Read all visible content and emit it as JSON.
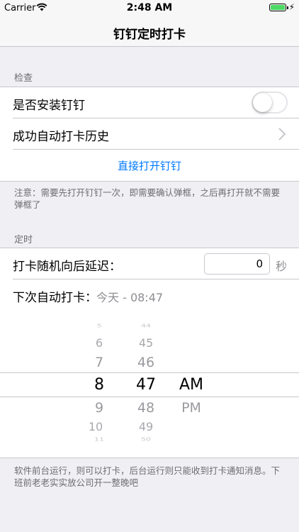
{
  "status_bar": {
    "carrier": "Carrier",
    "time": "2:48 AM",
    "battery_percent": 100
  },
  "nav": {
    "title": "钉钉定时打卡"
  },
  "check_section": {
    "header": "检查",
    "rows": [
      {
        "label": "是否安装钉钉",
        "toggle_on": false
      },
      {
        "label": "成功自动打卡历史"
      },
      {
        "action": "直接打开钉钉"
      }
    ],
    "note": "注意：需要先打开钉钉一次，即需要确认弹框，之后再打开就不需要弹框了"
  },
  "timer_section": {
    "header": "定时",
    "delay": {
      "label": "打卡随机向后延迟：",
      "value": "0",
      "unit": "秒"
    },
    "next": {
      "label": "下次自动打卡：",
      "value": "今天 - 08:47"
    },
    "picker": {
      "hours": [
        "5",
        "6",
        "7",
        "8",
        "9",
        "10",
        "11"
      ],
      "minutes": [
        "44",
        "45",
        "46",
        "47",
        "48",
        "49",
        "50"
      ],
      "periods": [
        "AM",
        "PM"
      ],
      "selected": {
        "hour": "8",
        "minute": "47",
        "period": "AM"
      }
    },
    "note": "软件前台运行，则可以打卡，后台运行则只能收到打卡通知消息。下班前老老实实放公司开一整晚吧"
  },
  "colors": {
    "accent": "#007aff",
    "secondary_text": "#8e8e93",
    "background": "#efeff4"
  }
}
